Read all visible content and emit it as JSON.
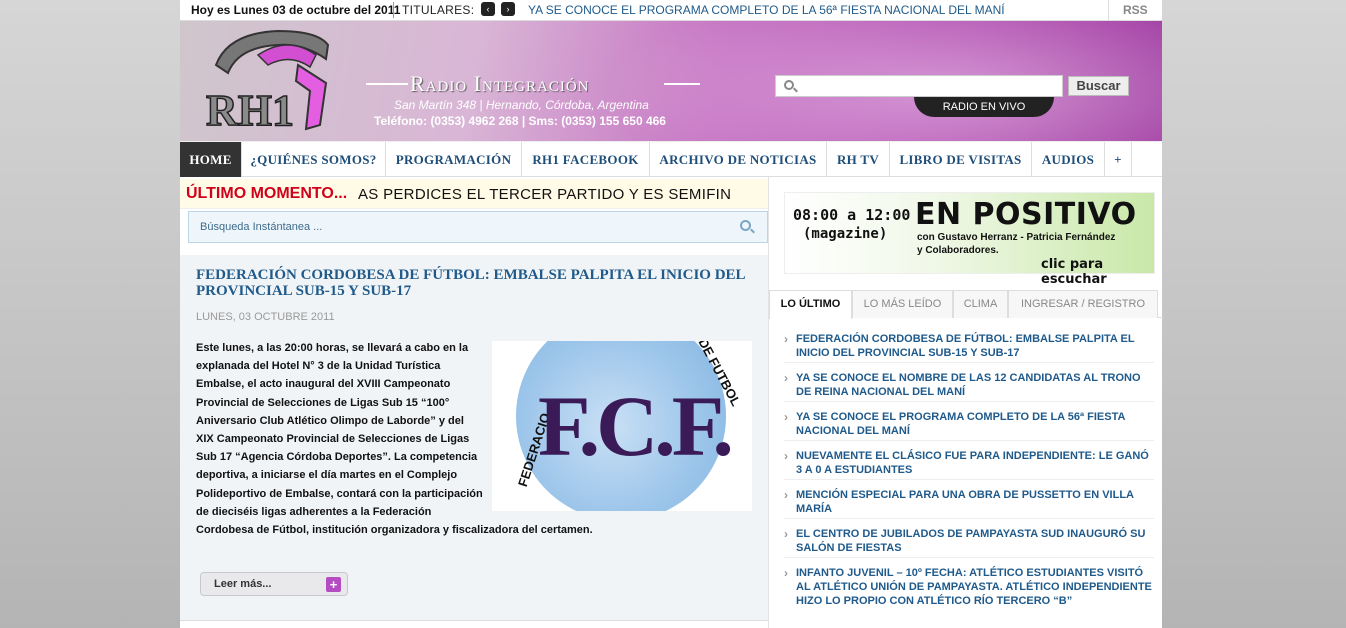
{
  "topbar": {
    "date": "Hoy es Lunes 03 de octubre del 2011",
    "titulares_label": "TITULARES:",
    "prev_icon": "‹",
    "next_icon": "›",
    "headline": "YA SE CONOCE EL PROGRAMA COMPLETO DE LA 56ª FIESTA NACIONAL DEL MANÍ",
    "rss": "RSS"
  },
  "header": {
    "logo_text": "RH1",
    "brand": "Radio Integración",
    "address": "San Martín 348 | Hernando, Córdoba, Argentina",
    "phone": "Teléfono: (0353) 4962 268 | Sms: (0353) 155 650 466",
    "search_placeholder": "",
    "search_button": "Buscar",
    "live_label": "RADIO EN VIVO"
  },
  "nav": {
    "items": [
      {
        "label": "HOME"
      },
      {
        "label": "¿QUIÉNES SOMOS?"
      },
      {
        "label": "PROGRAMACIÓN"
      },
      {
        "label": "RH1 FACEBOOK"
      },
      {
        "label": "ARCHIVO DE NOTICIAS"
      },
      {
        "label": "RH TV"
      },
      {
        "label": "LIBRO DE VISITAS"
      },
      {
        "label": "AUDIOS"
      },
      {
        "label": "+"
      }
    ]
  },
  "breaking": {
    "label": "ÚLTIMO MOMENTO...",
    "text": "AS PERDICES EL TERCER PARTIDO Y ES SEMIFIN"
  },
  "instant_search": {
    "placeholder": "Búsqueda Instántanea ..."
  },
  "article": {
    "title": "FEDERACIÓN CORDOBESA DE FÚTBOL: EMBALSE PALPITA EL INICIO DEL PROVINCIAL SUB-15 Y SUB-17",
    "date": "LUNES, 03 OCTUBRE 2011",
    "body": "Este lunes, a las 20:00 horas, se llevará a cabo en la explanada del Hotel N° 3 de la Unidad Turística Embalse, el acto inaugural del XVIII Campeonato Provincial de Selecciones de Ligas Sub 15 “100° Aniversario Club Atlético Olimpo de Laborde” y del XIX Campeonato Provincial de Selecciones de Ligas Sub 17 “Agencia Córdoba Deportes”. La competencia deportiva, a iniciarse el día martes en el Complejo Polideportivo de Embalse, contará con la participación de dieciséis ligas adherentes a la Federación Cordobesa de Fútbol, institución organizadora y fiscalizadora del certamen.",
    "image_text": "F.C.F.",
    "image_ring_left": "FEDERACIO",
    "image_ring_right": "DE FUTBOL",
    "read_more": "Leer más...",
    "read_more_icon": "+"
  },
  "sidebar": {
    "banner": {
      "time": "08:00 a 12:00",
      "type": "(magazine)",
      "title": "EN POSITIVO",
      "hosts_line1": "con Gustavo Herranz - Patricia Fernández",
      "hosts_line2": "y Colaboradores.",
      "cta": "clic para escuchar"
    },
    "tabs": [
      {
        "label": "LO ÚLTIMO"
      },
      {
        "label": "LO MÁS LEÍDO"
      },
      {
        "label": "CLIMA"
      },
      {
        "label": "INGRESAR / REGISTRO"
      }
    ],
    "news": [
      {
        "title": "FEDERACIÓN CORDOBESA DE FÚTBOL: EMBALSE PALPITA EL INICIO DEL PROVINCIAL SUB-15 Y SUB-17"
      },
      {
        "title": "YA SE CONOCE EL NOMBRE DE LAS 12 CANDIDATAS AL TRONO DE REINA NACIONAL DEL MANÍ"
      },
      {
        "title": "YA SE CONOCE EL PROGRAMA COMPLETO DE LA 56ª FIESTA NACIONAL DEL MANÍ"
      },
      {
        "title": "NUEVAMENTE EL CLÁSICO FUE PARA INDEPENDIENTE: LE GANÓ 3 A 0 A ESTUDIANTES"
      },
      {
        "title": "MENCIÓN ESPECIAL PARA UNA OBRA DE PUSSETTO EN VILLA MARÍA"
      },
      {
        "title": "EL CENTRO DE JUBILADOS DE PAMPAYASTA SUD INAUGURÓ SU SALÓN DE FIESTAS"
      },
      {
        "title": "INFANTO JUVENIL – 10º FECHA: ATLÉTICO ESTUDIANTES VISITÓ AL ATLÉTICO UNIÓN DE PAMPAYASTA. ATLÉTICO INDEPENDIENTE HIZO LO PROPIO CON ATLÉTICO RÍO TERCERO “B”"
      }
    ]
  }
}
